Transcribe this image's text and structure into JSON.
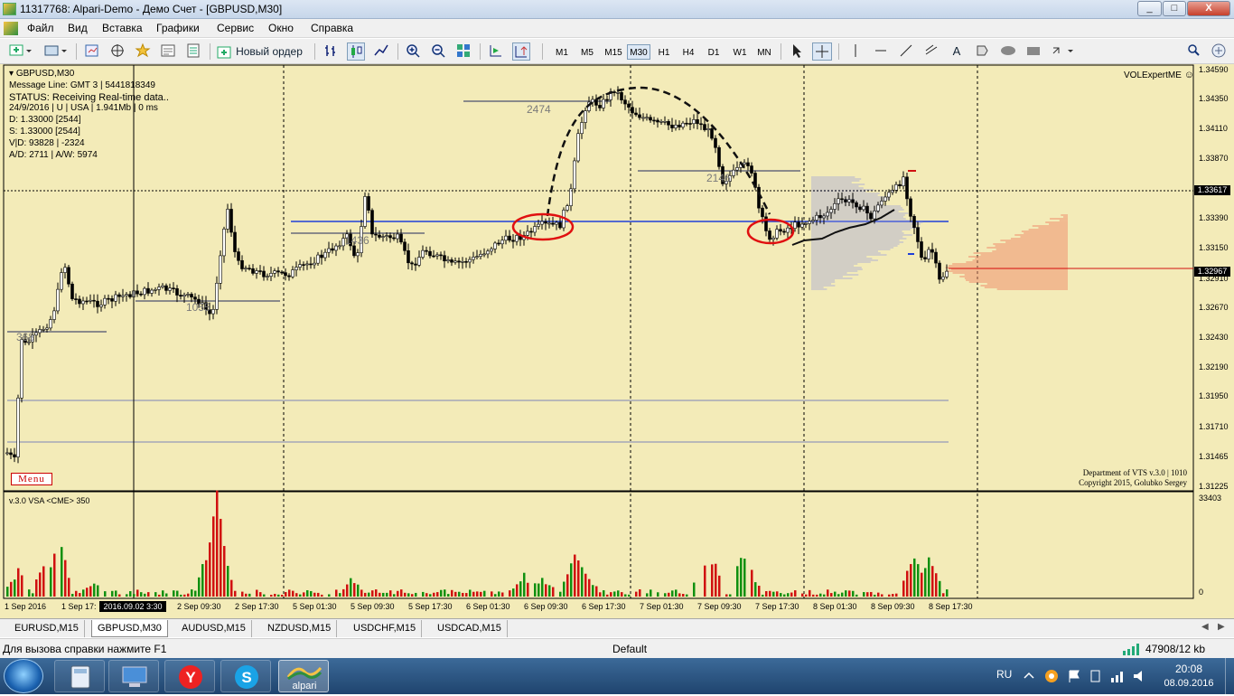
{
  "window": {
    "title": "11317768: Alpari-Demo - Демо Счет - [GBPUSD,M30]",
    "minimize": "_",
    "maximize": "□",
    "close": "X"
  },
  "menu": [
    "Файл",
    "Вид",
    "Вставка",
    "Графики",
    "Сервис",
    "Окно",
    "Справка"
  ],
  "toolbar": {
    "new_order": "Новый ордер",
    "timeframes": [
      "M1",
      "M5",
      "M15",
      "M30",
      "H1",
      "H4",
      "D1",
      "W1",
      "MN"
    ],
    "active_timeframe": "M30",
    "drawing_text_tool": "A"
  },
  "chart": {
    "symbol_header": "GBPUSD,M30",
    "info_lines": [
      "Message Line: GMT 3 | 5441818349",
      "STATUS:  Receiving Real-time data..",
      "24/9/2016 | U | USA | 1.941Mb | 0 ms",
      "D: 1.33000  [2544]",
      "S: 1.33000  [2544]",
      "V|D: 93828 | -2324",
      "A/D: 2711 | A/W: 5974"
    ],
    "expert_name": "VOLExpertME",
    "dept_line1": "Department of VTS  v.3.0 | 1010",
    "dept_line2": "Copyright 2015, Golubko Sergey",
    "menu_button": "Menu",
    "zone_labels": [
      "2474",
      "2146",
      "1436",
      "368",
      "1055"
    ],
    "price_labels": [
      "1.34590",
      "1.34350",
      "1.34110",
      "1.33870",
      "1.33617",
      "1.33390",
      "1.33150",
      "1.32967",
      "1.32910",
      "1.32670",
      "1.32430",
      "1.32190",
      "1.31950",
      "1.31710",
      "1.31465",
      "1.31225"
    ],
    "highlight_prices": [
      "1.33617",
      "1.32967"
    ],
    "indicator_label": "v.3.0 VSA <CME> 350",
    "indicator_scale": [
      "33403",
      "0"
    ],
    "time_labels": [
      "1 Sep 2016",
      "1 Sep 17:",
      "2 Sep 09:30",
      "2 Sep 17:30",
      "5 Sep 01:30",
      "5 Sep 09:30",
      "5 Sep 17:30",
      "6 Sep 01:30",
      "6 Sep 09:30",
      "6 Sep 17:30",
      "7 Sep 01:30",
      "7 Sep 09:30",
      "7 Sep 17:30",
      "8 Sep 01:30",
      "8 Sep 09:30",
      "8 Sep 17:30"
    ],
    "cursor_time": "2016.09.02 3:30"
  },
  "symbol_tabs": [
    "EURUSD,M15",
    "GBPUSD,M30",
    "AUDUSD,M15",
    "NZDUSD,M15",
    "USDCHF,M15",
    "USDCAD,M15"
  ],
  "active_tab": "GBPUSD,M30",
  "status": {
    "help": "Для вызова справки нажмите F1",
    "profile": "Default",
    "traffic": "47908/12 kb"
  },
  "taskbar": {
    "alpari_label": "alpari",
    "lang": "RU",
    "time": "20:08",
    "date": "08.09.2016"
  },
  "colors": {
    "chart_bg": "#f3ebb8",
    "accent_blue": "#1f3fd8",
    "bull": "#109010",
    "bear": "#d01010",
    "highlight_circle": "#e01010"
  }
}
